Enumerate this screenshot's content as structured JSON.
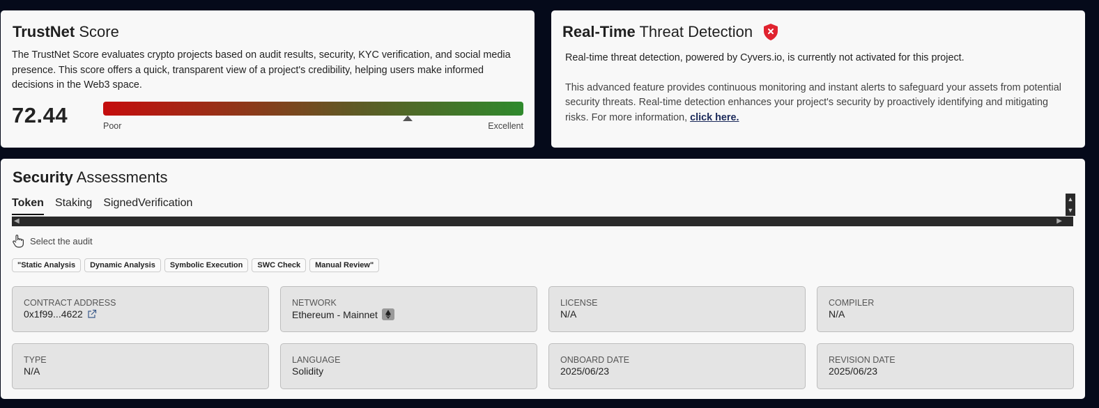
{
  "trustnet": {
    "title_bold": "TrustNet",
    "title_rest": " Score",
    "description": "The TrustNet Score evaluates crypto projects based on audit results, security, KYC verification, and social media presence. This score offers a quick, transparent view of a project's credibility, helping users make informed decisions in the Web3 space.",
    "score": "72.44",
    "gauge_fraction": 0.7244,
    "low_label": "Poor",
    "high_label": "Excellent"
  },
  "threat": {
    "title_bold": "Real-Time",
    "title_rest": " Threat Detection",
    "status_icon": "shield-x-icon",
    "status_color": "#e0232f",
    "paragraph1": "Real-time threat detection, powered by Cyvers.io, is currently not activated for this project.",
    "paragraph2": "This advanced feature provides continuous monitoring and instant alerts to safeguard your assets from potential security threats. Real-time detection enhances your project's security by proactively identifying and mitigating risks. For more information, ",
    "link_text": "click here."
  },
  "assessments": {
    "title_bold": "Security",
    "title_rest": " Assessments",
    "tabs": [
      {
        "label": "Token",
        "active": true
      },
      {
        "label": "Staking",
        "active": false
      },
      {
        "label": "SignedVerification",
        "active": false
      }
    ],
    "select_hint": "Select the audit",
    "chips": [
      "\"Static Analysis",
      "Dynamic Analysis",
      "Symbolic Execution",
      "SWC Check",
      "Manual Review\""
    ],
    "fields": [
      {
        "label": "CONTRACT ADDRESS",
        "value": "0x1f99...4622",
        "icon": "external-link-icon"
      },
      {
        "label": "NETWORK",
        "value": "Ethereum - Mainnet",
        "icon": "ethereum-icon"
      },
      {
        "label": "LICENSE",
        "value": "N/A"
      },
      {
        "label": "COMPILER",
        "value": "N/A"
      },
      {
        "label": "TYPE",
        "value": "N/A"
      },
      {
        "label": "LANGUAGE",
        "value": "Solidity"
      },
      {
        "label": "ONBOARD DATE",
        "value": "2025/06/23"
      },
      {
        "label": "REVISION DATE",
        "value": "2025/06/23"
      }
    ]
  }
}
